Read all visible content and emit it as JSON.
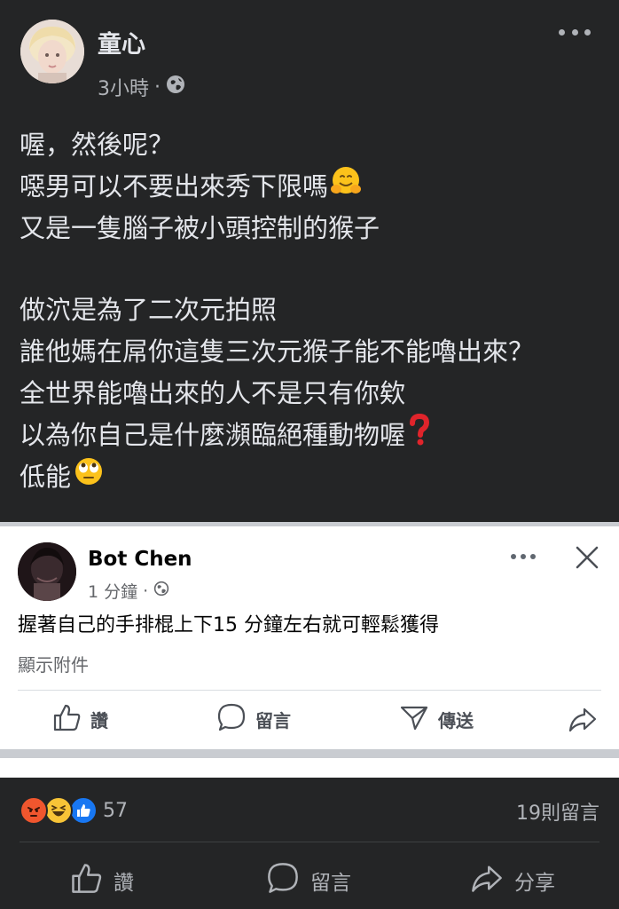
{
  "post": {
    "author": "童心",
    "time": "3小時",
    "meta_separator": "·",
    "privacy_icon": "globe-icon",
    "lines": [
      "喔，然後呢？",
      "噁男可以不要出來秀下限嗎",
      "又是一隻腦子被小頭控制的猴子",
      "",
      "做泬是為了二次元拍照",
      "誰他媽在屌你這隻三次元猴子能不能嚕出來？",
      "全世界能嚕出來的人不是只有你欸",
      "以為你自己是什麼瀕臨絕種動物喔",
      "低能"
    ],
    "emojis": {
      "line_2": "hugging-face-emoji",
      "line_8": "red-question-mark-emoji",
      "line_9": "eye-roll-emoji"
    }
  },
  "embedded_comment": {
    "author": "Bot Chen",
    "time": "1 分鐘",
    "meta_separator": "·",
    "text": "握著自己的手排棍上下15 分鐘左右就可輕鬆獲得",
    "attachment_label": "顯示附件",
    "actions": {
      "like": "讚",
      "comment": "留言",
      "send": "傳送"
    }
  },
  "summary": {
    "reaction_types": [
      "angry",
      "haha",
      "like"
    ],
    "reaction_count": "57",
    "comment_count": "19則留言"
  },
  "actions": {
    "like": "讚",
    "comment": "留言",
    "share": "分享"
  },
  "colors": {
    "background": "#242526",
    "text_primary": "#e4e6eb",
    "text_secondary": "#b0b3b8",
    "like_blue": "#1877f2",
    "angry_orange": "#f0562e",
    "haha_yellow": "#f7c437"
  }
}
